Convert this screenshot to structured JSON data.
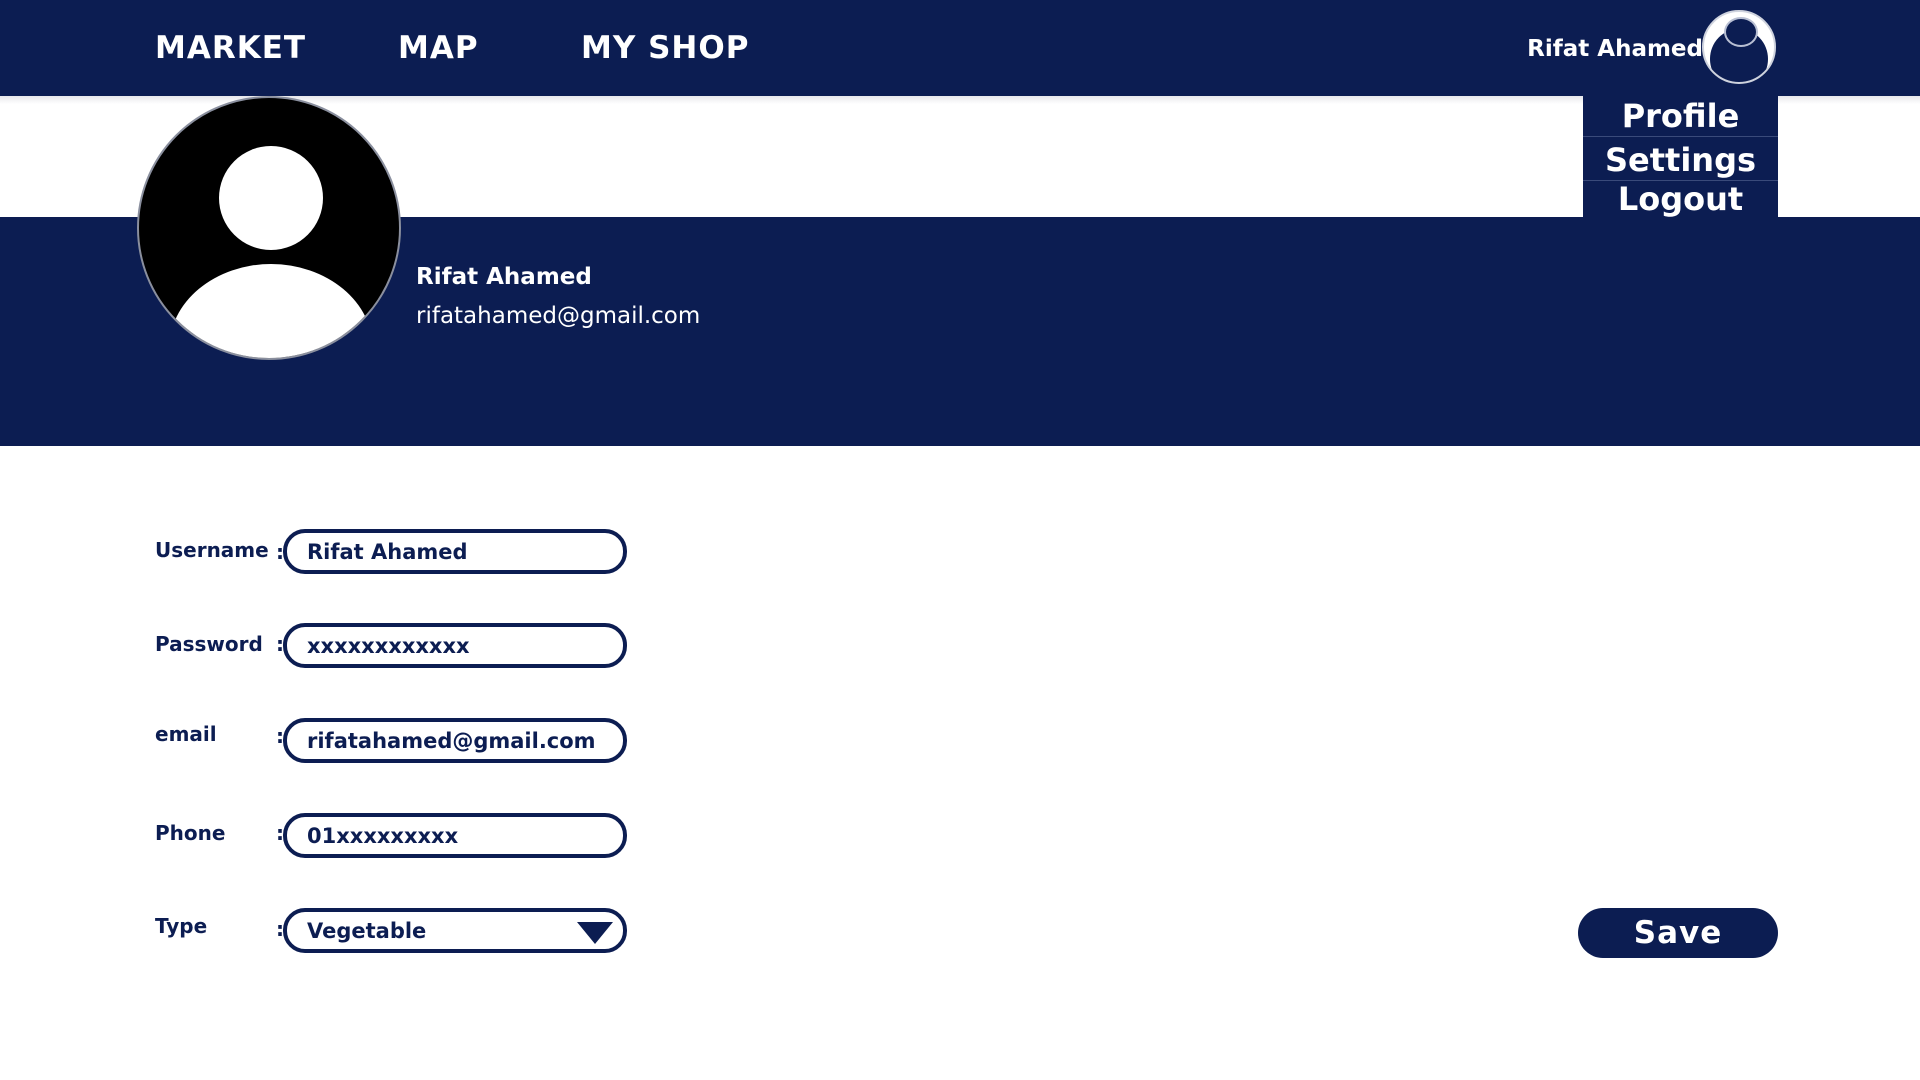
{
  "nav": {
    "links": [
      "MARKET",
      "MAP",
      "MY SHOP"
    ],
    "user_name": "Rifat Ahamed",
    "avatar_icon": "user-avatar-icon"
  },
  "dropdown": {
    "items": [
      "Profile",
      "Settings",
      "Logout"
    ]
  },
  "profile": {
    "name": "Rifat Ahamed",
    "email": "rifatahamed@gmail.com"
  },
  "form": {
    "username": {
      "label": "Username",
      "value": "Rifat Ahamed"
    },
    "password": {
      "label": "Password",
      "value": "xxxxxxxxxxxx"
    },
    "email": {
      "label": "email",
      "value": "rifatahamed@gmail.com"
    },
    "phone": {
      "label": "Phone",
      "value": "01xxxxxxxxx"
    },
    "type": {
      "label": "Type",
      "value": "Vegetable"
    },
    "colon": ":",
    "save_label": "Save"
  },
  "colors": {
    "primary": "#0c1d52",
    "background": "#ffffff"
  }
}
